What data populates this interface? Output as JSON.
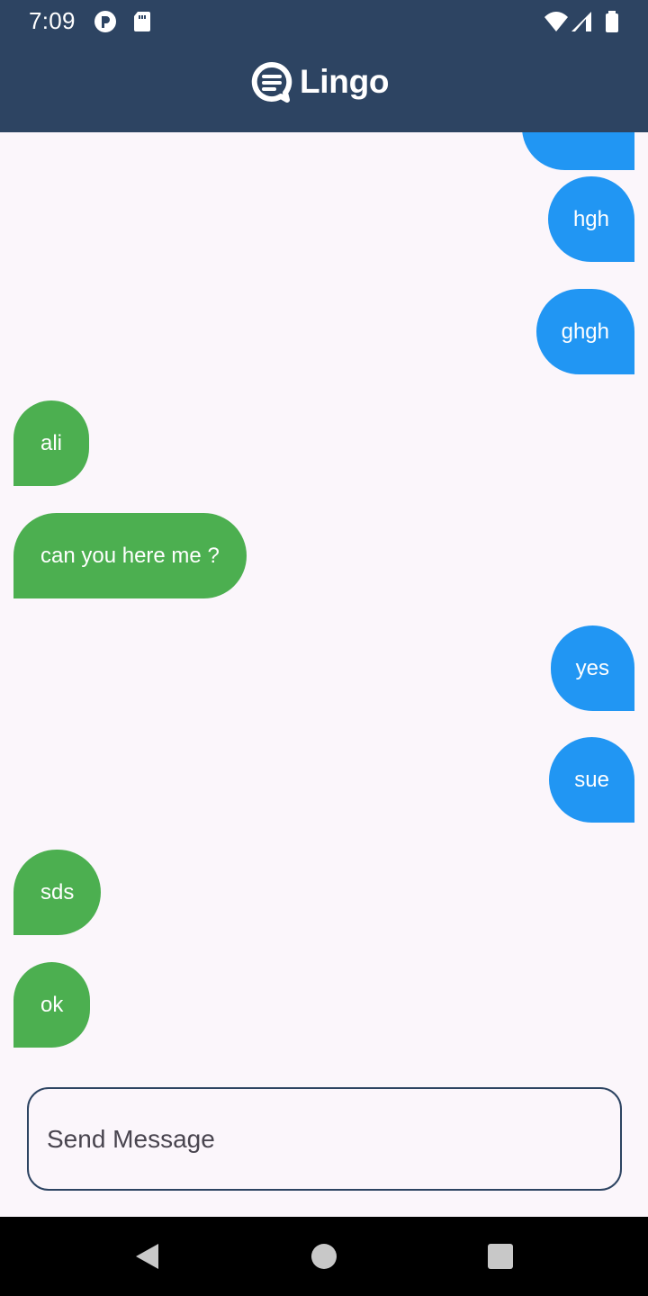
{
  "status_bar": {
    "time": "7:09",
    "icons": [
      "notification-app-icon",
      "sd-card-icon",
      "wifi-icon",
      "signal-icon",
      "battery-icon"
    ]
  },
  "header": {
    "title": "Lingo",
    "logo_icon": "chat-logo-icon",
    "background": "#2d4462"
  },
  "messages": [
    {
      "text": "",
      "direction": "sent"
    },
    {
      "text": "hgh",
      "direction": "sent"
    },
    {
      "text": "ghgh",
      "direction": "sent"
    },
    {
      "text": "ali",
      "direction": "received"
    },
    {
      "text": "can you here me ?",
      "direction": "received"
    },
    {
      "text": "yes",
      "direction": "sent"
    },
    {
      "text": "sue",
      "direction": "sent"
    },
    {
      "text": "sds",
      "direction": "received"
    },
    {
      "text": "ok",
      "direction": "received"
    }
  ],
  "composer": {
    "placeholder": "Send Message",
    "value": ""
  },
  "colors": {
    "sent_bubble": "#2196f3",
    "received_bubble": "#4caf50",
    "background": "#fbf6fb",
    "navigation_bar": "#000000"
  },
  "navigation": {
    "back_icon": "back-icon",
    "home_icon": "home-icon",
    "recents_icon": "recents-icon"
  }
}
